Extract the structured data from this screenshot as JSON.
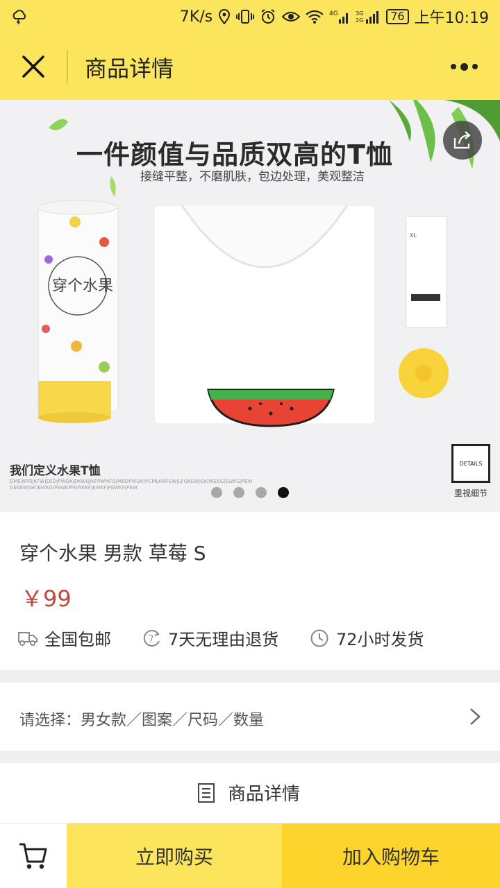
{
  "status_bar": {
    "speed": "7K/s",
    "battery": "76",
    "time": "上午10:19",
    "signal_labels": [
      "4G",
      "3G 2G"
    ]
  },
  "header": {
    "title": "商品详情"
  },
  "hero": {
    "headline": "一件颜值与品质双高的T恤",
    "subline": "接缝平整，不磨肌肤，包边处理，美观整洁",
    "caption": "我们定义水果T恤",
    "caption_small": "DMEWPOJKFW|EKD|PWQK|DKWQ|KFPWMFQ|MKDPWQK|VCMLKMFEW|LFGKEW|GK|WEKG|EWKG|PEW GEKEW|GK|EWKG|PEWKPFKWEKF|EWKF|PEWKF|PEW",
    "details_label": "DETAILS",
    "details_caption": "重视细节",
    "pager_total": 4,
    "pager_active": 4
  },
  "product": {
    "name": "穿个水果 男款 草莓 S",
    "price": "￥99",
    "features": [
      {
        "icon": "truck-icon",
        "label": "全国包邮"
      },
      {
        "icon": "seven-day-icon",
        "label": "7天无理由退货"
      },
      {
        "icon": "clock-icon",
        "label": "72小时发货"
      }
    ]
  },
  "selection": {
    "label": "请选择：男女款／图案／尺码／数量"
  },
  "detail_section": {
    "label": "商品详情"
  },
  "bottom_bar": {
    "buy_label": "立即购买",
    "add_cart_label": "加入购物车"
  },
  "colors": {
    "accent_yellow": "#fbe55c",
    "cart_yellow": "#fcd42b",
    "price_red": "#c2453a"
  }
}
